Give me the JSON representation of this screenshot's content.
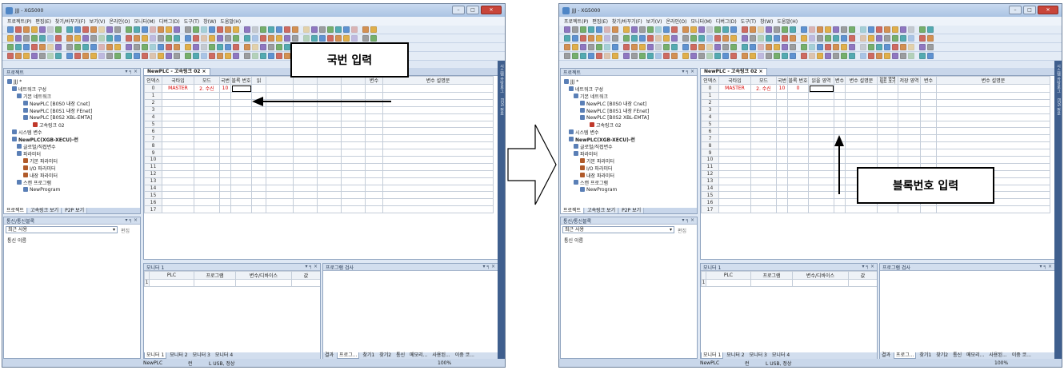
{
  "window": {
    "title": "JJJ - XG5000",
    "min_glyph": "–",
    "max_glyph": "□",
    "close_glyph": "✕"
  },
  "menu": [
    "프로젝트(P)",
    "편집(E)",
    "찾기/바꾸기(F)",
    "보기(V)",
    "온라인(O)",
    "모니터(M)",
    "디버그(D)",
    "도구(T)",
    "창(W)",
    "도움말(H)"
  ],
  "project_pane": {
    "title": "프로젝트",
    "pin": "▾ ╕ ×",
    "tree": [
      "JJJ *",
      "네트워크 구성",
      "기본 네트워크",
      "NewPLC [B0S0 내장 Cnet]",
      "NewPLC [B0S1 내장 FEnet]",
      "NewPLC [B0S2 XBL-EMTA]",
      "고속링크 02",
      "시스템 변수",
      "NewPLC(XGB-XECU)-런",
      "글로벌/직접변수",
      "파라미터",
      "기본 파라미터",
      "I/O 파라미터",
      "내장 파라미터",
      "스캔 프로그램",
      "NewProgram"
    ],
    "tabs": [
      "프로젝트",
      "고속링크 보기",
      "P2P 보기"
    ]
  },
  "comm_pane": {
    "title": "통신/통신블록",
    "pin": "▾ ╕ ×",
    "combo_value": "최근 사용",
    "edit_label": "편집",
    "item": "통신 이름"
  },
  "doc_tab": "NewPLC - 고속링크 02",
  "doc_tab_close": "×",
  "left_grid": {
    "headers": [
      "인덱스",
      "국타입",
      "모드",
      "국번",
      "블록 번호",
      "읽",
      "",
      "",
      "",
      "",
      "변수",
      "변수 설명문"
    ],
    "row0": [
      "0",
      "MASTER",
      "2. 수신",
      "10",
      "",
      "",
      "",
      "",
      "",
      "",
      "",
      ""
    ]
  },
  "right_grid": {
    "headers": [
      "인덱스",
      "국타입",
      "모드",
      "국번",
      "블록 번호",
      "읽을 영역",
      "변수",
      "변수 설명문",
      "읽을 영역\n워드 크기",
      "저장 영역",
      "변수",
      "변수 설명문"
    ],
    "row0": [
      "0",
      "MASTER",
      "2. 수신",
      "10",
      "0",
      "",
      "",
      "",
      "",
      "",
      "",
      ""
    ]
  },
  "row_indices": [
    "1",
    "2",
    "3",
    "4",
    "5",
    "6",
    "7",
    "8",
    "9",
    "10",
    "11",
    "12",
    "13",
    "14",
    "15",
    "16",
    "17"
  ],
  "monitor": {
    "title": "모니터 1",
    "pin": "▾ ╕ ×",
    "headers": [
      "PLC",
      "프로그램",
      "변수/디바이스",
      "값"
    ],
    "row_index": "1",
    "tabs": [
      "모니터 1",
      "모니터 2",
      "모니터 3",
      "모니터 4"
    ]
  },
  "program_check": {
    "title": "프로그램 검사",
    "pin": "▾ ╕ ×",
    "tabs": [
      "결과",
      "프로그...",
      "찾기1",
      "찾기2",
      "통신",
      "메모리...",
      "사용된...",
      "이중 코..."
    ]
  },
  "statusbar": {
    "plc": "NewPLC",
    "mode": "런",
    "conn": "L USB, 정상",
    "zoom": "100%"
  },
  "sidebar_strip": [
    "시스템 카탈로그",
    "EDS 정보"
  ],
  "callouts": {
    "left": "국번 입력",
    "right": "블록번호 입력"
  },
  "colors": {
    "accent": "#4f86c6",
    "red_text": "#d60000",
    "frame": "#6b7f99"
  }
}
